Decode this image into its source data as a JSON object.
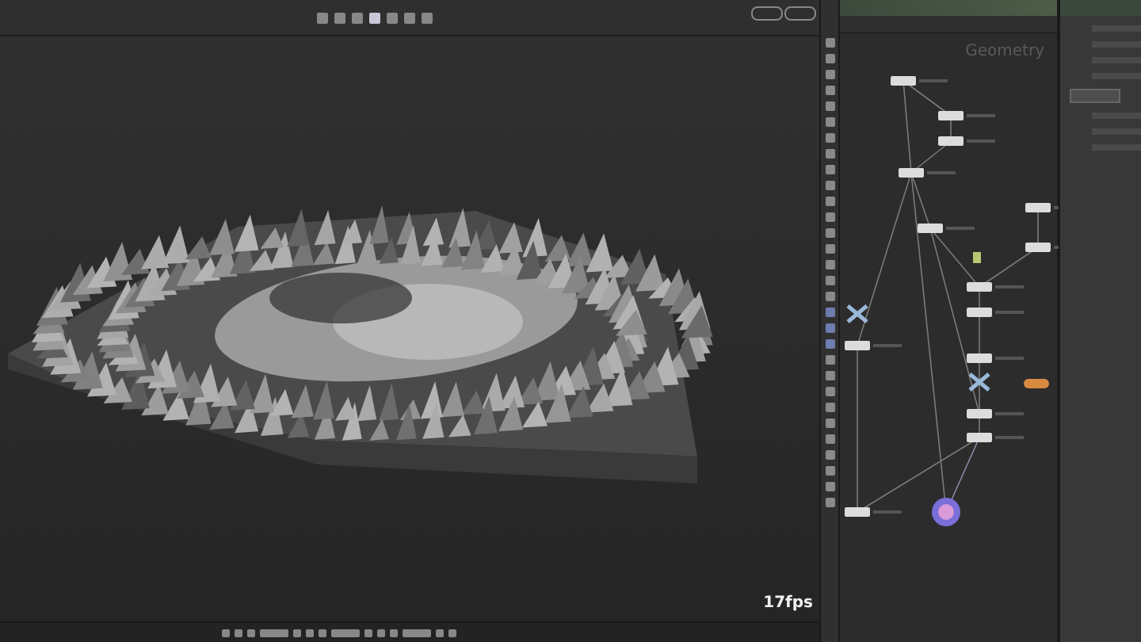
{
  "viewport": {
    "fps": "17fps"
  },
  "network": {
    "context_label": "Geometry"
  }
}
